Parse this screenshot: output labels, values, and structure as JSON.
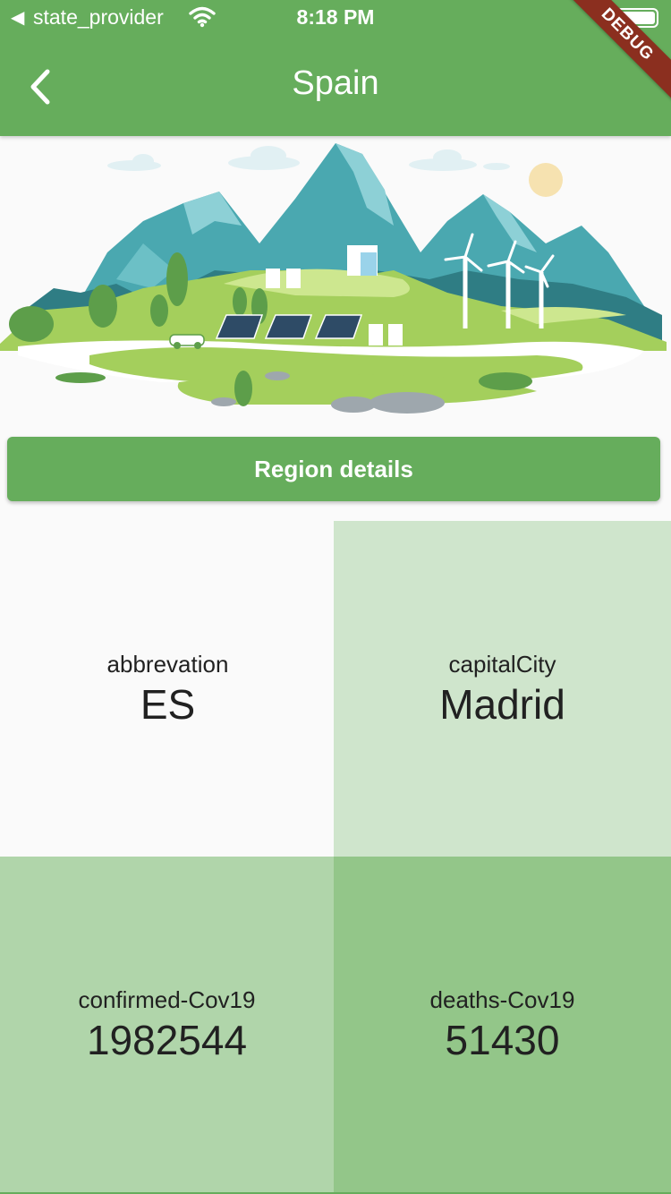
{
  "status_bar": {
    "back_glyph": "◀",
    "app_name": "state_provider",
    "time": "8:18 PM",
    "icons": [
      "wifi-icon",
      "battery-icon"
    ]
  },
  "debug_banner": "DEBUG",
  "app_bar": {
    "title": "Spain",
    "back_icon": "chevron-left-icon"
  },
  "region_button_label": "Region details",
  "stats": [
    {
      "label": "abbrevation",
      "value": "ES"
    },
    {
      "label": "capitalCity",
      "value": "Madrid"
    },
    {
      "label": "confirmed-Cov19",
      "value": "1982544"
    },
    {
      "label": "deaths-Cov19",
      "value": "51430"
    }
  ],
  "colors": {
    "primary_green": "#66ad5c",
    "tile_light": "#cfe5cc",
    "tile_medium": "#b0d5aa",
    "tile_dark": "#93c689",
    "debug_red": "#8b2f1f"
  }
}
